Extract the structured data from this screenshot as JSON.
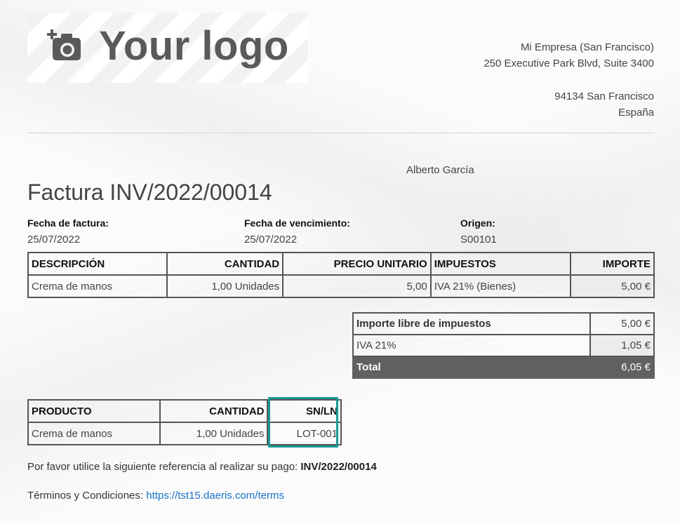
{
  "logo": {
    "text": "Your logo",
    "icon": "camera-add-icon"
  },
  "company": {
    "name": "Mi Empresa (San Francisco)",
    "street": "250 Executive Park Blvd, Suite 3400",
    "city": "94134 San Francisco",
    "country": "España"
  },
  "customer": {
    "name": "Alberto García"
  },
  "invoice": {
    "title": "Factura INV/2022/00014",
    "date_label": "Fecha de factura:",
    "date": "25/07/2022",
    "due_label": "Fecha de vencimiento:",
    "due": "25/07/2022",
    "origin_label": "Origen:",
    "origin": "S00101"
  },
  "lines": {
    "headers": [
      "DESCRIPCIÓN",
      "CANTIDAD",
      "PRECIO UNITARIO",
      "IMPUESTOS",
      "IMPORTE"
    ],
    "rows": [
      [
        "Crema de manos",
        "1,00 Unidades",
        "5,00",
        "IVA 21% (Bienes)",
        "5,00 €"
      ]
    ]
  },
  "totals": {
    "untaxed_label": "Importe libre de impuestos",
    "untaxed": "5,00 €",
    "tax_label": "IVA 21%",
    "tax": "1,05 €",
    "total_label": "Total",
    "total": "6,05 €"
  },
  "lots": {
    "headers": [
      "PRODUCTO",
      "CANTIDAD",
      "SN/LN"
    ],
    "rows": [
      [
        "Crema de manos",
        "1,00 Unidades",
        "LOT-001"
      ]
    ]
  },
  "payment": {
    "text": "Por favor utilice la siguiente referencia al realizar su pago: ",
    "reference": "INV/2022/00014"
  },
  "terms": {
    "label": "Términos y Condiciones: ",
    "link": "https://tst15.daeris.com/terms"
  },
  "colors": {
    "highlight": "#1a9a96",
    "total_bg": "#616161",
    "link": "#1a73c8"
  }
}
